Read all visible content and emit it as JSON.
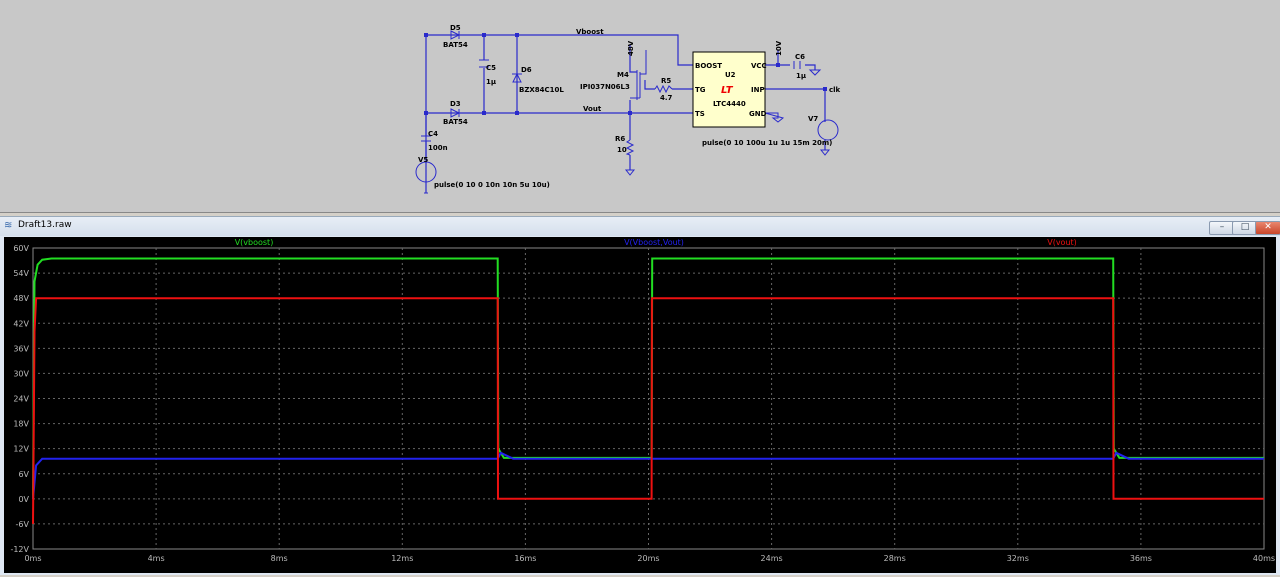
{
  "schematic": {
    "labels": {
      "d5": "D5",
      "d5_model": "BAT54",
      "d3": "D3",
      "d3_model": "BAT54",
      "c5": "C5",
      "c5_val": "1µ",
      "d6": "D6",
      "d6_model": "BZX84C10L",
      "c4": "C4",
      "c4_val": "100n",
      "v5": "V5",
      "v5_val": "pulse(0 10 0 10n 10n 5u 10u)",
      "net_vboost": "Vboost",
      "net_vout": "Vout",
      "m4": "M4",
      "m4_model": "IPI037N06L3",
      "v48": "48V",
      "r5": "R5",
      "r5_val": "4.7",
      "r6": "R6",
      "r6_val": "10",
      "u2": "U2",
      "u2_part": "LTC4440",
      "pin_boost": "BOOST",
      "pin_tg": "TG",
      "pin_ts": "TS",
      "pin_vcc": "VCC",
      "pin_inp": "INP",
      "pin_gnd": "GND",
      "v10": "10V",
      "c6": "C6",
      "c6_val": "1µ",
      "net_clk": "clk",
      "v7": "V7",
      "v7_val": "pulse(0 10 100u 1u 1u 15m 20m)",
      "logo": "LT"
    }
  },
  "window": {
    "title": "Draft13.raw",
    "minimize": "–",
    "maximize": "□",
    "close": "✕"
  },
  "chart_data": {
    "type": "line",
    "xlabel": "",
    "ylabel": "",
    "xlim": [
      0,
      40
    ],
    "ylim": [
      -12,
      60
    ],
    "x_unit": "ms",
    "y_unit": "V",
    "x_ticks": [
      "0ms",
      "4ms",
      "8ms",
      "12ms",
      "16ms",
      "20ms",
      "24ms",
      "28ms",
      "32ms",
      "36ms",
      "40ms"
    ],
    "y_ticks": [
      "60V",
      "54V",
      "48V",
      "42V",
      "36V",
      "30V",
      "24V",
      "18V",
      "12V",
      "6V",
      "0V",
      "-6V",
      "-12V"
    ],
    "grid": true,
    "series": [
      {
        "name": "V(vboost)",
        "color": "#22dd22",
        "x": [
          0,
          0.05,
          0.15,
          0.3,
          0.6,
          15.1,
          15.12,
          15.3,
          20.1,
          20.12,
          35.1,
          35.12,
          35.3,
          40
        ],
        "y": [
          0,
          52,
          56,
          57.2,
          57.5,
          57.5,
          12,
          9.8,
          9.8,
          57.5,
          57.5,
          12,
          9.8,
          9.8
        ]
      },
      {
        "name": "V(Vboost,Vout)",
        "color": "#2222ee",
        "x": [
          0,
          0.1,
          0.3,
          15.1,
          15.2,
          15.6,
          20.1,
          35.1,
          35.2,
          35.6,
          40
        ],
        "y": [
          0,
          8,
          9.6,
          9.6,
          11,
          9.6,
          9.6,
          9.6,
          11,
          9.6,
          9.6
        ]
      },
      {
        "name": "V(vout)",
        "color": "#ee1111",
        "x": [
          0,
          0.05,
          0.1,
          15.1,
          15.11,
          20.1,
          20.11,
          35.1,
          35.11,
          40
        ],
        "y": [
          -6,
          40,
          48,
          48,
          0,
          0,
          48,
          48,
          0,
          0
        ]
      }
    ]
  }
}
